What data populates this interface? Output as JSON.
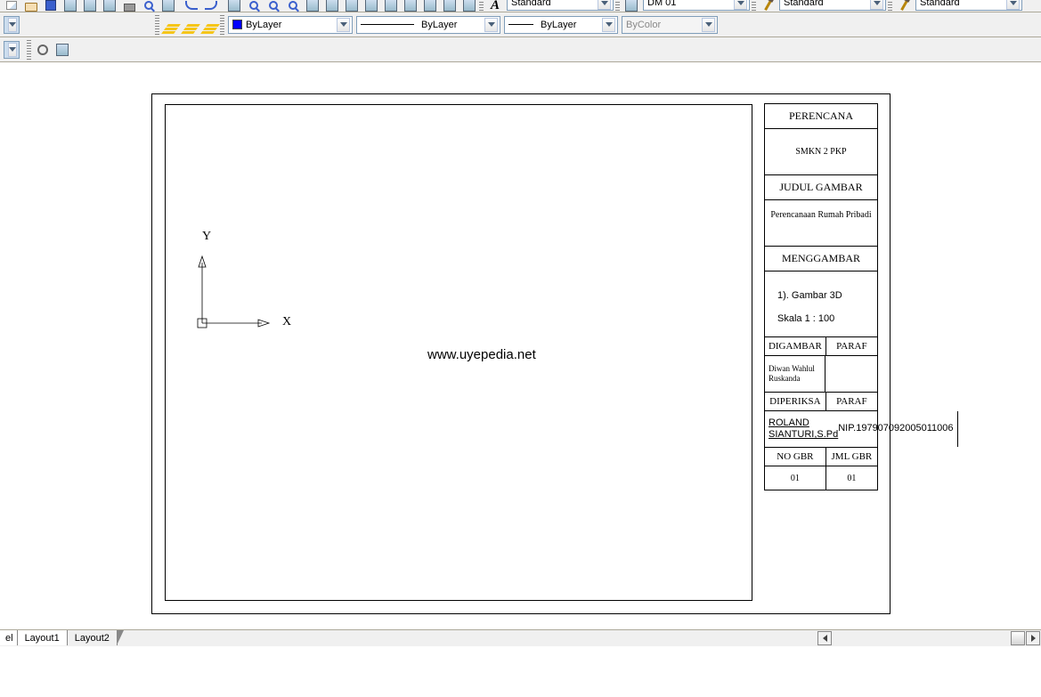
{
  "dropdowns": {
    "standard1": "Standard",
    "dm01": "DM 01",
    "standard2": "Standard",
    "standard3": "Standard",
    "layer": "ByLayer",
    "linetype": "ByLayer",
    "lineweight": "ByLayer",
    "plotstyle": "ByColor"
  },
  "ucs": {
    "y": "Y",
    "x": "X"
  },
  "watermark": "www.uyepedia.net",
  "titleblock": {
    "perencana_h": "PERENCANA",
    "perencana_v": "SMKN 2 PKP",
    "judul_h": "JUDUL GAMBAR",
    "judul_v": "Perencanaan Rumah Pribadi",
    "menggambar_h": "MENGGAMBAR",
    "menggambar_item": "1). Gambar 3D",
    "menggambar_skala": "Skala 1 : 100",
    "digambar_h": "DIGAMBAR",
    "paraf_h": "PARAF",
    "digambar_v": "Diwan Wahlul Ruskanda",
    "diperiksa_h": "DIPERIKSA",
    "diperiksa_name": "ROLAND SIANTURI,S.Pd",
    "diperiksa_nip": "NIP.197907092005011006",
    "nogbr_h": "NO GBR",
    "jmlgbr_h": "JML GBR",
    "nogbr_v": "01",
    "jmlgbr_v": "01"
  },
  "tabs": {
    "partial": "el",
    "layout1": "Layout1",
    "layout2": "Layout2"
  }
}
